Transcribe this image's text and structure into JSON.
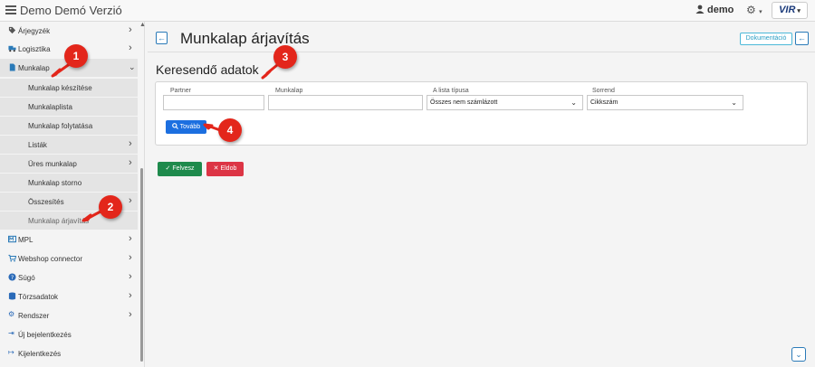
{
  "app": {
    "title": "Demo Demó Verzió"
  },
  "header": {
    "user": "demo",
    "logo_text": "VIR"
  },
  "sidebar": {
    "items": [
      {
        "label": "Árjegyzék",
        "icon": "tag-icon"
      },
      {
        "label": "Logisztika",
        "icon": "truck-icon"
      },
      {
        "label": "Munkalap",
        "icon": "file-icon"
      },
      {
        "label": "Munkalap készítése"
      },
      {
        "label": "Munkalaplista"
      },
      {
        "label": "Munkalap folytatása"
      },
      {
        "label": "Listák"
      },
      {
        "label": "Üres munkalap"
      },
      {
        "label": "Munkalap storno"
      },
      {
        "label": "Összesítés"
      },
      {
        "label": "Munkalap árjavítás"
      },
      {
        "label": "MPL",
        "icon": "mpl-icon"
      },
      {
        "label": "Webshop connector",
        "icon": "cart-icon"
      },
      {
        "label": "Súgó",
        "icon": "help-icon"
      },
      {
        "label": "Törzsadatok",
        "icon": "database-icon"
      },
      {
        "label": "Rendszer",
        "icon": "cogs-icon"
      },
      {
        "label": "Új bejelentkezés",
        "icon": "login-icon"
      },
      {
        "label": "Kijelentkezés",
        "icon": "logout-icon"
      }
    ]
  },
  "main": {
    "page_title": "Munkalap árjavítás",
    "doc_button": "Dokumentáció",
    "section_title": "Keresendő adatok",
    "form": {
      "partner_label": "Partner",
      "partner_value": "",
      "munkalap_label": "Munkalap",
      "munkalap_value": "",
      "list_type_label": "A lista típusa",
      "list_type_value": "Összes nem számlázott",
      "order_label": "Sorrend",
      "order_value": "Cikkszám",
      "next_button": "Tovább"
    },
    "save_button": "Felvesz",
    "discard_button": "Eldob"
  },
  "markers": [
    "1",
    "2",
    "3",
    "4"
  ],
  "colors": {
    "primary": "#1c6fe0",
    "success": "#1e8a4c",
    "danger": "#dc3545",
    "marker": "#e3261b"
  }
}
